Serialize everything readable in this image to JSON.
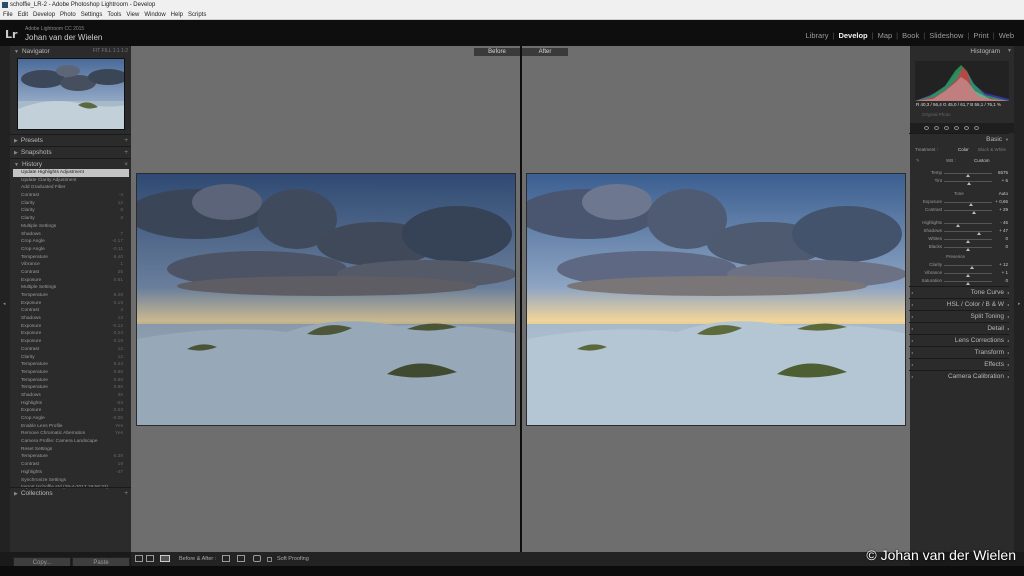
{
  "window": {
    "title": "schoffie_LR-2 - Adobe Photoshop Lightroom - Develop"
  },
  "menu": [
    "File",
    "Edit",
    "Develop",
    "Photo",
    "Settings",
    "Tools",
    "View",
    "Window",
    "Help",
    "Scripts"
  ],
  "identity": {
    "logo": "Lr",
    "version": "Adobe Lightroom CC 2015",
    "owner": "Johan van der Wielen"
  },
  "modules": [
    "Library",
    "Develop",
    "Map",
    "Book",
    "Slideshow",
    "Print",
    "Web"
  ],
  "active_module": "Develop",
  "left": {
    "navigator": "Navigator",
    "nav_options": "FIT  FILL  1:1  1:2",
    "presets": "Presets",
    "snapshots": "Snapshots",
    "history": "History",
    "collections": "Collections",
    "copy_label": "Copy...",
    "paste_label": "Paste",
    "history_items": [
      {
        "label": "Update Highlights Adjustment",
        "value": "",
        "selected": true
      },
      {
        "label": "Update Clarity Adjustment",
        "value": ""
      },
      {
        "label": "Add Graduated Filter",
        "value": ""
      },
      {
        "label": "Contrast",
        "value": "-4"
      },
      {
        "label": "Clarity",
        "value": "12"
      },
      {
        "label": "Clarity",
        "value": "8"
      },
      {
        "label": "Clarity",
        "value": "3"
      },
      {
        "label": "Multiple Settings",
        "value": ""
      },
      {
        "label": "Shadows",
        "value": "7"
      },
      {
        "label": "Crop Angle",
        "value": "-0.17"
      },
      {
        "label": "Crop Angle",
        "value": "-0.11"
      },
      {
        "label": "Temperature",
        "value": "6.40"
      },
      {
        "label": "Vibrance",
        "value": "1"
      },
      {
        "label": "Contrast",
        "value": "25"
      },
      {
        "label": "Exposure",
        "value": "0.61"
      },
      {
        "label": "Multiple Settings",
        "value": ""
      },
      {
        "label": "Temperature",
        "value": "6.48"
      },
      {
        "label": "Exposure",
        "value": "0.19"
      },
      {
        "label": "Contrast",
        "value": "4"
      },
      {
        "label": "Shadows",
        "value": "13"
      },
      {
        "label": "Exposure",
        "value": "-0.12"
      },
      {
        "label": "Exposure",
        "value": "0.24"
      },
      {
        "label": "Exposure",
        "value": "0.19"
      },
      {
        "label": "Contrast",
        "value": "12"
      },
      {
        "label": "Clarity",
        "value": "12"
      },
      {
        "label": "Temperature",
        "value": "6.44"
      },
      {
        "label": "Temperature",
        "value": "5.98"
      },
      {
        "label": "Temperature",
        "value": "5.88"
      },
      {
        "label": "Temperature",
        "value": "5.86"
      },
      {
        "label": "Shadows",
        "value": "36"
      },
      {
        "label": "Highlights",
        "value": "-53"
      },
      {
        "label": "Exposure",
        "value": "0.53"
      },
      {
        "label": "Crop Angle",
        "value": "-0.06"
      },
      {
        "label": "Enable Lens Profile",
        "value": "Yes"
      },
      {
        "label": "Remove Chromatic Aberration",
        "value": "Yes"
      },
      {
        "label": "Camera Profile: Camera Landscape",
        "value": ""
      },
      {
        "label": "Reset Settings",
        "value": ""
      },
      {
        "label": "Temperature",
        "value": "6.38"
      },
      {
        "label": "Contrast",
        "value": "19"
      },
      {
        "label": "Highlights",
        "value": "-47"
      },
      {
        "label": "Synchronize Settings",
        "value": ""
      },
      {
        "label": "Import (schoffie std (29-4-2017 19:58:32)",
        "value": ""
      }
    ]
  },
  "viewer": {
    "before": "Before",
    "after": "After"
  },
  "toolbar": {
    "mode": "Before & After :",
    "proof": "Soft Proofing"
  },
  "right": {
    "histogram": "Histogram",
    "histo_values": "R  40,3 / 56,4     G  45,0 / 61,7     B  56,1 / 76,1 %",
    "original_photo": "Original Photo",
    "basic": "Basic",
    "treatment": "Treatment :",
    "treatment_color": "Color",
    "treatment_bw": "Black & White",
    "wb": "WB :",
    "wb_value": "Custom",
    "tone": "Tone",
    "tone_auto": "Auto",
    "presence": "Presence",
    "sliders_wb": [
      {
        "label": "Temp",
        "value": "6575",
        "pos": 0.5
      },
      {
        "label": "Tint",
        "value": "+ 6",
        "pos": 0.52
      }
    ],
    "sliders_tone": [
      {
        "label": "Exposure",
        "value": "+ 0,65",
        "pos": 0.56
      },
      {
        "label": "Contrast",
        "value": "+ 29",
        "pos": 0.62
      }
    ],
    "sliders_hs": [
      {
        "label": "Highlights",
        "value": "- 45",
        "pos": 0.3
      },
      {
        "label": "Shadows",
        "value": "+ 47",
        "pos": 0.72
      },
      {
        "label": "Whites",
        "value": "0",
        "pos": 0.5
      },
      {
        "label": "Blacks",
        "value": "0",
        "pos": 0.5
      }
    ],
    "sliders_presence": [
      {
        "label": "Clarity",
        "value": "+ 12",
        "pos": 0.58
      },
      {
        "label": "Vibrance",
        "value": "+ 1",
        "pos": 0.5
      },
      {
        "label": "Saturation",
        "value": "0",
        "pos": 0.5
      }
    ],
    "tone_curve": "Tone Curve",
    "hsl": "HSL  /  Color  /  B & W",
    "split_toning": "Split Toning",
    "detail": "Detail",
    "lens": "Lens Corrections",
    "transform": "Transform",
    "effects": "Effects",
    "calibration": "Camera Calibration"
  },
  "copyright": "© Johan van der Wielen"
}
